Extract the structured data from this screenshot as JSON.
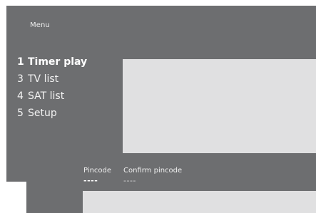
{
  "menu": {
    "title": "Menu",
    "items": [
      {
        "number": "1",
        "label": "Timer play",
        "active": true
      },
      {
        "number": "3",
        "label": "TV list",
        "active": false
      },
      {
        "number": "4",
        "label": "SAT list",
        "active": false
      },
      {
        "number": "5",
        "label": "Setup",
        "active": false
      }
    ]
  },
  "pin_dialog": {
    "pincode_label": "Pincode",
    "confirm_label": "Confirm pincode",
    "pincode_value": "----",
    "confirm_value": "----"
  },
  "colors": {
    "panel": "#6d6e70",
    "content": "#e0e0e1",
    "text": "#f2f2f2"
  }
}
